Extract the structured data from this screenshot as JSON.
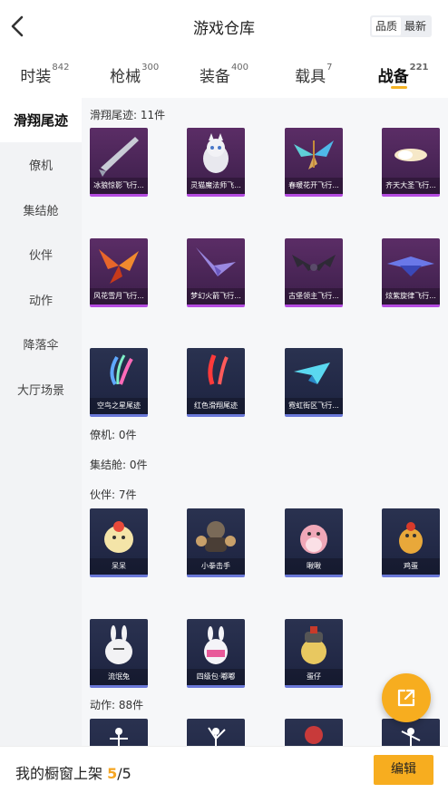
{
  "header": {
    "title": "游戏仓库",
    "sort_options": [
      "品质",
      "最新"
    ],
    "sort_active": 0
  },
  "tabs": [
    {
      "label": "时装",
      "count": "842"
    },
    {
      "label": "枪械",
      "count": "300"
    },
    {
      "label": "装备",
      "count": "400"
    },
    {
      "label": "载具",
      "count": "7"
    },
    {
      "label": "战备",
      "count": "221"
    }
  ],
  "active_tab": 4,
  "sidebar": {
    "items": [
      "滑翔尾迹",
      "僚机",
      "集结舱",
      "伙伴",
      "动作",
      "降落伞",
      "大厅场景"
    ],
    "active": 0
  },
  "sections": {
    "glide": {
      "label": "滑翔尾迹: 11件",
      "items": [
        "冰狼惊影飞行...",
        "灵猫魔法师飞...",
        "春暖花开飞行...",
        "齐天大圣飞行...",
        "风花雪月飞行...",
        "梦幻火箭飞行...",
        "古堡领主飞行...",
        "炫紫旋律飞行...",
        "空鸟之星尾迹",
        "红色滑翔尾迹",
        "霓虹街区飞行..."
      ]
    },
    "wingman": {
      "label": "僚机: 0件"
    },
    "capsule": {
      "label": "集结舱: 0件"
    },
    "partner": {
      "label": "伙伴: 7件",
      "items": [
        "呆呆",
        "小拳击手",
        "啾啾",
        "鸡蛋",
        "流氓兔",
        "四级包·嘟嘟",
        "蛋仔"
      ]
    },
    "action": {
      "label": "动作: 88件"
    }
  },
  "footer": {
    "prefix": "我的橱窗上架",
    "current": "5",
    "sep": "/",
    "total": "5",
    "edit_label": "编辑"
  },
  "colors": {
    "accent": "#f7ad1f",
    "purple_tier": "#b44be0",
    "blue_tier": "#6a78d8"
  }
}
